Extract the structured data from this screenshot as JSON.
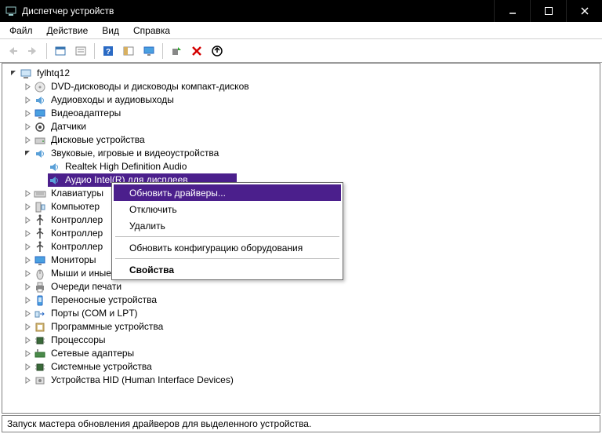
{
  "titlebar": {
    "title": "Диспетчер устройств"
  },
  "menubar": {
    "items": [
      "Файл",
      "Действие",
      "Вид",
      "Справка"
    ]
  },
  "tree": {
    "root": "fylhtq12",
    "items": [
      {
        "label": "DVD-дисководы и дисководы компакт-дисков",
        "expanded": false
      },
      {
        "label": "Аудиовходы и аудиовыходы",
        "expanded": false
      },
      {
        "label": "Видеоадаптеры",
        "expanded": false
      },
      {
        "label": "Датчики",
        "expanded": false
      },
      {
        "label": "Дисковые устройства",
        "expanded": false
      },
      {
        "label": "Звуковые, игровые и видеоустройства",
        "expanded": true,
        "children": [
          {
            "label": "Realtek High Definition Audio"
          },
          {
            "label": "Аудио Intel(R) для дисплеев",
            "selected": true
          }
        ]
      },
      {
        "label": "Клавиатуры",
        "expanded": false
      },
      {
        "label": "Компьютер",
        "expanded": false
      },
      {
        "label": "Контроллер",
        "expanded": false,
        "truncated": true
      },
      {
        "label": "Контроллер",
        "expanded": false,
        "truncated": true
      },
      {
        "label": "Контроллер",
        "expanded": false,
        "truncated": true
      },
      {
        "label": "Мониторы",
        "expanded": false
      },
      {
        "label": "Мыши и иные указывающие устройства",
        "expanded": false
      },
      {
        "label": "Очереди печати",
        "expanded": false
      },
      {
        "label": "Переносные устройства",
        "expanded": false
      },
      {
        "label": "Порты (COM и LPT)",
        "expanded": false
      },
      {
        "label": "Программные устройства",
        "expanded": false
      },
      {
        "label": "Процессоры",
        "expanded": false
      },
      {
        "label": "Сетевые адаптеры",
        "expanded": false
      },
      {
        "label": "Системные устройства",
        "expanded": false
      },
      {
        "label": "Устройства HID (Human Interface Devices)",
        "expanded": false
      }
    ]
  },
  "contextmenu": {
    "items": [
      {
        "label": "Обновить драйверы...",
        "highlighted": true
      },
      {
        "label": "Отключить"
      },
      {
        "label": "Удалить"
      },
      {
        "sep": true
      },
      {
        "label": "Обновить конфигурацию оборудования"
      },
      {
        "sep": true
      },
      {
        "label": "Свойства",
        "bold": true
      }
    ]
  },
  "statusbar": {
    "text": "Запуск мастера обновления драйверов для выделенного устройства."
  }
}
